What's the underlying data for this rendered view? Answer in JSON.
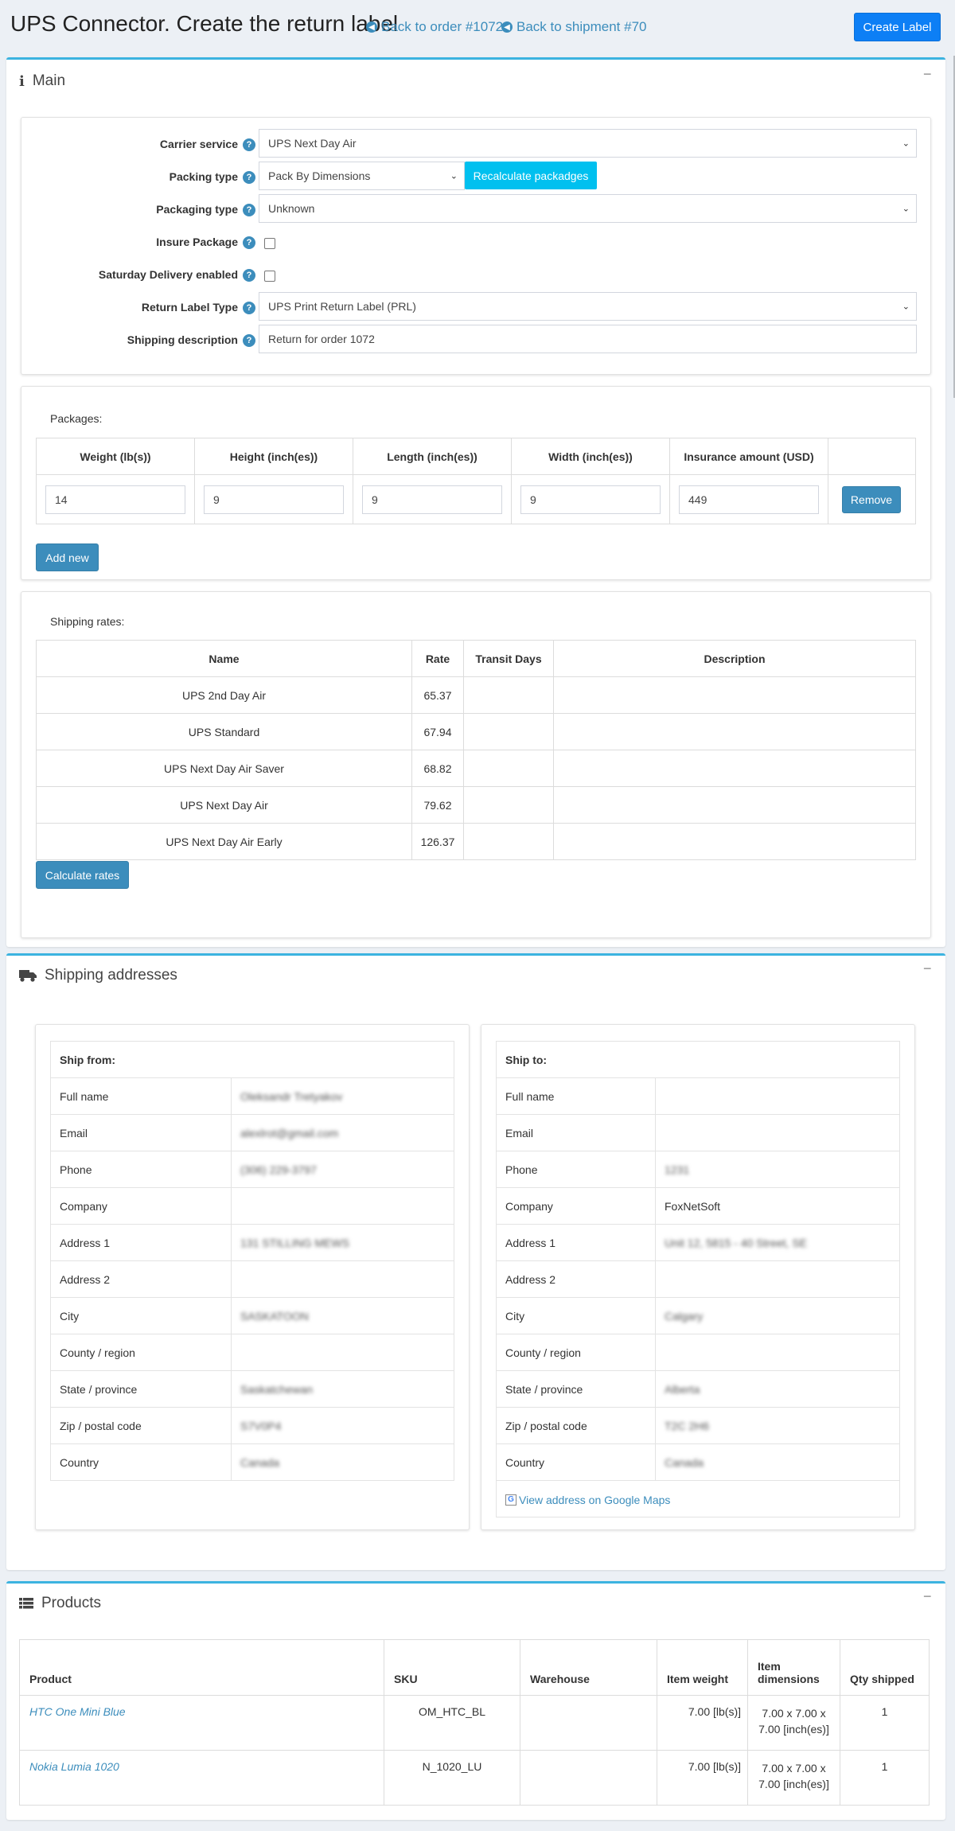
{
  "header": {
    "title": "UPS Connector. Create the return label",
    "back_order": "Back to order #1072",
    "back_shipment": "Back to shipment #70",
    "create_label": "Create Label"
  },
  "main": {
    "title": "Main",
    "collapse": "−",
    "form": {
      "carrier_service": {
        "label": "Carrier service",
        "value": "UPS Next Day Air"
      },
      "packing_type": {
        "label": "Packing type",
        "value": "Pack By Dimensions",
        "button": "Recalculate packadges"
      },
      "packaging_type": {
        "label": "Packaging type",
        "value": "Unknown"
      },
      "insure_package": {
        "label": "Insure Package",
        "checked": false
      },
      "saturday_delivery": {
        "label": "Saturday Delivery enabled",
        "checked": false
      },
      "return_label_type": {
        "label": "Return Label Type",
        "value": "UPS Print Return Label (PRL)"
      },
      "shipping_description": {
        "label": "Shipping description",
        "value": "Return for order 1072"
      }
    },
    "packages": {
      "label": "Packages:",
      "headers": [
        "Weight (lb(s))",
        "Height (inch(es))",
        "Length (inch(es))",
        "Width (inch(es))",
        "Insurance amount (USD)",
        ""
      ],
      "row": {
        "weight": "14",
        "height": "9",
        "length": "9",
        "width": "9",
        "insurance": "449",
        "remove": "Remove"
      },
      "add_new": "Add new"
    },
    "rates": {
      "label": "Shipping rates:",
      "headers": {
        "name": "Name",
        "rate": "Rate",
        "transit": "Transit Days",
        "description": "Description"
      },
      "rows": [
        {
          "name": "UPS 2nd Day Air",
          "rate": "65.37",
          "transit": "",
          "description": ""
        },
        {
          "name": "UPS Standard",
          "rate": "67.94",
          "transit": "",
          "description": ""
        },
        {
          "name": "UPS Next Day Air Saver",
          "rate": "68.82",
          "transit": "",
          "description": ""
        },
        {
          "name": "UPS Next Day Air",
          "rate": "79.62",
          "transit": "",
          "description": ""
        },
        {
          "name": "UPS Next Day Air Early",
          "rate": "126.37",
          "transit": "",
          "description": ""
        }
      ],
      "calculate": "Calculate rates"
    }
  },
  "addresses": {
    "title": "Shipping addresses",
    "collapse": "−",
    "from": {
      "heading": "Ship from:",
      "rows": [
        {
          "label": "Full name",
          "value": "Oleksandr Tretyakov",
          "blurred": true
        },
        {
          "label": "Email",
          "value": "alexlrot@gmail.com",
          "blurred": true
        },
        {
          "label": "Phone",
          "value": "(306) 229-3797",
          "blurred": true
        },
        {
          "label": "Company",
          "value": "",
          "blurred": false
        },
        {
          "label": "Address 1",
          "value": "131 STILLING MEWS",
          "blurred": true
        },
        {
          "label": "Address 2",
          "value": "",
          "blurred": false
        },
        {
          "label": "City",
          "value": "SASKATOON",
          "blurred": true
        },
        {
          "label": "County / region",
          "value": "",
          "blurred": false
        },
        {
          "label": "State / province",
          "value": "Saskatchewan",
          "blurred": true
        },
        {
          "label": "Zip / postal code",
          "value": "S7V0P4",
          "blurred": true
        },
        {
          "label": "Country",
          "value": "Canada",
          "blurred": true
        }
      ]
    },
    "to": {
      "heading": "Ship to:",
      "rows": [
        {
          "label": "Full name",
          "value": "",
          "blurred": false
        },
        {
          "label": "Email",
          "value": "",
          "blurred": false
        },
        {
          "label": "Phone",
          "value": "1231",
          "blurred": true
        },
        {
          "label": "Company",
          "value": "FoxNetSoft",
          "blurred": false
        },
        {
          "label": "Address 1",
          "value": "Unit 12, 5815 - 40 Street, SE",
          "blurred": true
        },
        {
          "label": "Address 2",
          "value": "",
          "blurred": false
        },
        {
          "label": "City",
          "value": "Calgary",
          "blurred": true
        },
        {
          "label": "County / region",
          "value": "",
          "blurred": false
        },
        {
          "label": "State / province",
          "value": "Alberta",
          "blurred": true
        },
        {
          "label": "Zip / postal code",
          "value": "T2C 2H6",
          "blurred": true
        },
        {
          "label": "Country",
          "value": "Canada",
          "blurred": true
        }
      ],
      "map_link": "View address on Google Maps"
    }
  },
  "products": {
    "title": "Products",
    "collapse": "−",
    "headers": {
      "product": "Product",
      "sku": "SKU",
      "warehouse": "Warehouse",
      "weight": "Item weight",
      "dimensions": "Item dimensions",
      "qty": "Qty shipped"
    },
    "rows": [
      {
        "product": "HTC One Mini Blue",
        "sku": "OM_HTC_BL",
        "warehouse": "",
        "weight": "7.00 [lb(s)]",
        "dims1": "7.00 x 7.00 x",
        "dims2": "7.00 [inch(es)]",
        "qty": "1"
      },
      {
        "product": "Nokia Lumia 1020",
        "sku": "N_1020_LU",
        "warehouse": "",
        "weight": "7.00 [lb(s)]",
        "dims1": "7.00 x 7.00 x",
        "dims2": "7.00 [inch(es)]",
        "qty": "1"
      }
    ]
  }
}
